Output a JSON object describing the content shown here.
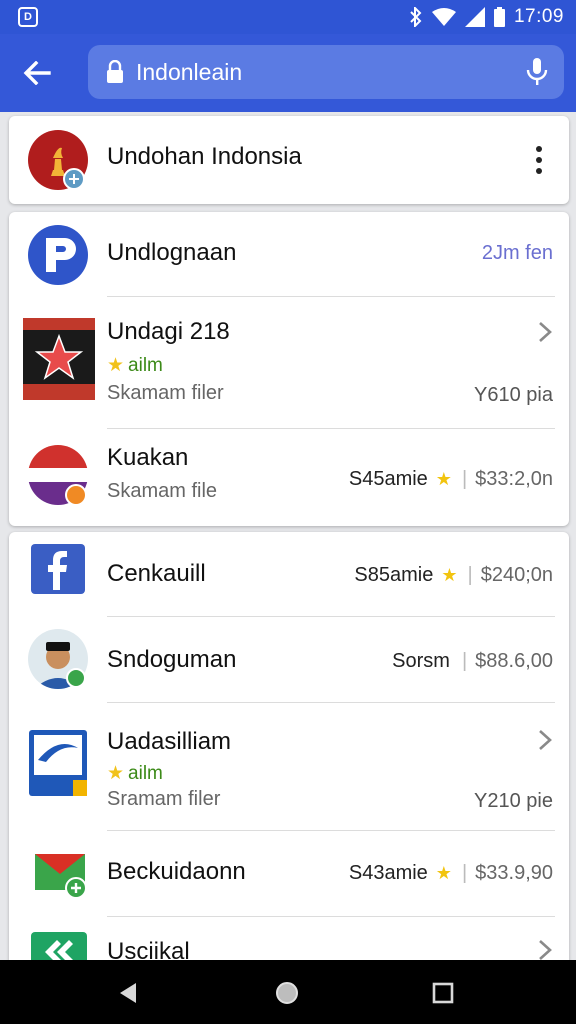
{
  "status_bar": {
    "notification_icon_text": "D",
    "time": "17:09",
    "icons": [
      "bluetooth-icon",
      "wifi-icon",
      "signal-icon",
      "battery-icon"
    ]
  },
  "app_bar": {
    "back_icon": "arrow-left-icon",
    "search": {
      "value": "Indonleain",
      "lock_icon": "lock-icon",
      "mic_icon": "mic-icon"
    }
  },
  "colors": {
    "status_bar": "#2f55d4",
    "app_bar": "#3458d8",
    "search_field": "#5b7be3",
    "rating_green": "#3c8a18",
    "star_yellow": "#f2c40f",
    "link_purple": "#6a6fd0"
  },
  "top_card": {
    "title": "Undohan Indonsia",
    "icon": "chess-piece-icon",
    "menu_icon": "more-vert-icon"
  },
  "results": [
    {
      "title": "Undlognaan",
      "icon": "p-logo-icon",
      "right_text": "2Jm fen"
    },
    {
      "title": "Undagi 218",
      "icon": "flag-banner-icon",
      "rating": "ailm",
      "size": "Skamam filer",
      "right_text": "Y610 pia",
      "chevron": "chevron-right-icon"
    },
    {
      "title": "Kuakan",
      "icon": "indonesia-flag-icon",
      "size": "Skamam file",
      "rating_label": "S45amie",
      "price": "$33:2,0n"
    }
  ],
  "more_results": [
    {
      "title": "Cenkauill",
      "icon": "facebook-icon",
      "rating_label": "S85amie",
      "price": "$240;0n"
    },
    {
      "title": "Sndoguman",
      "icon": "avatar-icon",
      "rating_label": "Sorsm",
      "price": "$88.6,00"
    },
    {
      "title": "Uadasilliam",
      "icon": "airline-icon",
      "rating": "ailm",
      "size": "Sramam filer",
      "right_text": "Y210 pie",
      "chevron": "chevron-right-icon"
    },
    {
      "title": "Beckuidaonn",
      "icon": "envelope-icon",
      "rating_label": "S43amie",
      "price": "$33.9,90"
    },
    {
      "title": "Usciikal",
      "icon": "green-app-icon",
      "chevron": "chevron-right-icon"
    }
  ],
  "nav_bar": {
    "back": "nav-back-icon",
    "home": "nav-home-icon",
    "recents": "nav-recents-icon"
  }
}
